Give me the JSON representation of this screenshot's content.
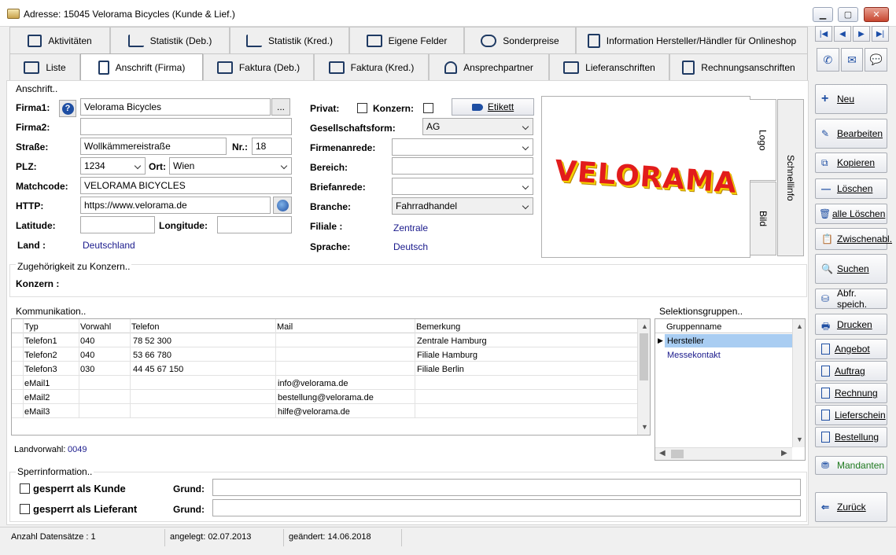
{
  "window": {
    "title": "Adresse: 15045 Velorama Bicycles (Kunde & Lief.)"
  },
  "tabs_top": [
    {
      "label": "Aktivitäten",
      "icon": "activities-icon"
    },
    {
      "label": "Statistik (Deb.)",
      "icon": "bar-chart-icon"
    },
    {
      "label": "Statistik (Kred.)",
      "icon": "bar-chart-icon"
    },
    {
      "label": "Eigene Felder",
      "icon": "custom-fields-icon"
    },
    {
      "label": "Sonderpreise",
      "icon": "handshake-icon"
    },
    {
      "label": "Information Hersteller/Händler für Onlineshop",
      "icon": "info-document-icon"
    }
  ],
  "tabs_bottom": [
    {
      "label": "Liste",
      "icon": "table-icon"
    },
    {
      "label": "Anschrift (Firma)",
      "icon": "building-icon"
    },
    {
      "label": "Faktura (Deb.)",
      "icon": "invoice-icon"
    },
    {
      "label": "Faktura (Kred.)",
      "icon": "invoice-icon"
    },
    {
      "label": "Ansprechpartner",
      "icon": "person-icon"
    },
    {
      "label": "Lieferanschriften",
      "icon": "truck-icon"
    },
    {
      "label": "Rechnungsanschriften",
      "icon": "billing-address-icon"
    }
  ],
  "address": {
    "group": "Anschrift..",
    "firma1_label": "Firma1:",
    "firma1": "Velorama Bicycles",
    "more_btn": "...",
    "firma2_label": "Firma2:",
    "firma2": "",
    "strasse_label": "Straße:",
    "strasse": "Wollkämmereistraße",
    "nr_label": "Nr.:",
    "nr": "18",
    "plz_label": "PLZ:",
    "plz": "1234",
    "ort_label": "Ort:",
    "ort": "Wien",
    "matchcode_label": "Matchcode:",
    "matchcode": "VELORAMA BICYCLES",
    "http_label": "HTTP:",
    "http": "https://www.velorama.de",
    "latitude_label": "Latitude:",
    "latitude": "",
    "longitude_label": "Longitude:",
    "longitude": "",
    "land_label": "Land :",
    "land": "Deutschland",
    "privat_label": "Privat:",
    "konzern_label": "Konzern:",
    "etikett_btn": "Etikett",
    "gesellschaftsform_label": "Gesellschaftsform:",
    "gesellschaftsform": "AG",
    "firmenanrede_label": "Firmenanrede:",
    "firmenanrede": "",
    "bereich_label": "Bereich:",
    "bereich": "",
    "briefanrede_label": "Briefanrede:",
    "briefanrede": "",
    "branche_label": "Branche:",
    "branche": "Fahrradhandel",
    "filiale_label": "Filiale :",
    "filiale": "Zentrale",
    "sprache_label": "Sprache:",
    "sprache": "Deutsch"
  },
  "logo": {
    "text": "VELORAMA",
    "tab_logo": "Logo",
    "tab_bild": "Bild",
    "tab_schnellinfo": "Schnellinfo"
  },
  "konzern": {
    "group": "Zugehörigkeit zu Konzern..",
    "label": "Konzern :"
  },
  "kommunikation": {
    "group": "Kommunikation..",
    "columns": [
      "Typ",
      "Vorwahl",
      "Telefon",
      "Mail",
      "Bemerkung"
    ],
    "rows": [
      [
        "Telefon1",
        "040",
        "78 52 300",
        "",
        "Zentrale Hamburg"
      ],
      [
        "Telefon2",
        "040",
        "53 66 780",
        "",
        "Filiale Hamburg"
      ],
      [
        "Telefon3",
        "030",
        "44 45 67 150",
        "",
        "Filiale Berlin"
      ],
      [
        "eMail1",
        "",
        "",
        "info@velorama.de",
        ""
      ],
      [
        "eMail2",
        "",
        "",
        "bestellung@velorama.de",
        ""
      ],
      [
        "eMail3",
        "",
        "",
        "hilfe@velorama.de",
        ""
      ]
    ],
    "landvorwahl_label": "Landvorwahl:",
    "landvorwahl": "0049"
  },
  "selektion": {
    "group": "Selektionsgruppen..",
    "column": "Gruppenname",
    "rows": [
      "Hersteller",
      "Messekontakt"
    ]
  },
  "sperr": {
    "group": "Sperrinformation..",
    "kunde_label": "gesperrt als Kunde",
    "lieferant_label": "gesperrt als Lieferant",
    "grund_label": "Grund:"
  },
  "status": {
    "count": "Anzahl Datensätze : 1",
    "created": "angelegt: 02.07.2013",
    "changed": "geändert: 14.06.2018"
  },
  "actions": [
    {
      "label": "Neu",
      "icon": "plus-icon"
    },
    {
      "label": "Bearbeiten",
      "icon": "pencil-icon"
    },
    {
      "label": "Kopieren",
      "icon": "copy-icon"
    },
    {
      "label": "Löschen",
      "icon": "minus-icon"
    },
    {
      "label": "alle Löschen",
      "icon": "trash-icon"
    },
    {
      "label": "Zwischenabl.",
      "icon": "clipboard-icon"
    },
    {
      "label": "Suchen",
      "icon": "search-icon"
    },
    {
      "label": "Abfr. speich.",
      "icon": "save-query-icon"
    },
    {
      "label": "Drucken",
      "icon": "printer-icon"
    },
    {
      "label": "Angebot",
      "icon": "document-icon"
    },
    {
      "label": "Auftrag",
      "icon": "document-icon"
    },
    {
      "label": "Rechnung",
      "icon": "document-icon"
    },
    {
      "label": "Lieferschein",
      "icon": "document-icon"
    },
    {
      "label": "Bestellung",
      "icon": "document-icon"
    },
    {
      "label": "Mandanten",
      "icon": "clients-icon"
    },
    {
      "label": "Zurück",
      "icon": "back-arrow-icon"
    }
  ]
}
